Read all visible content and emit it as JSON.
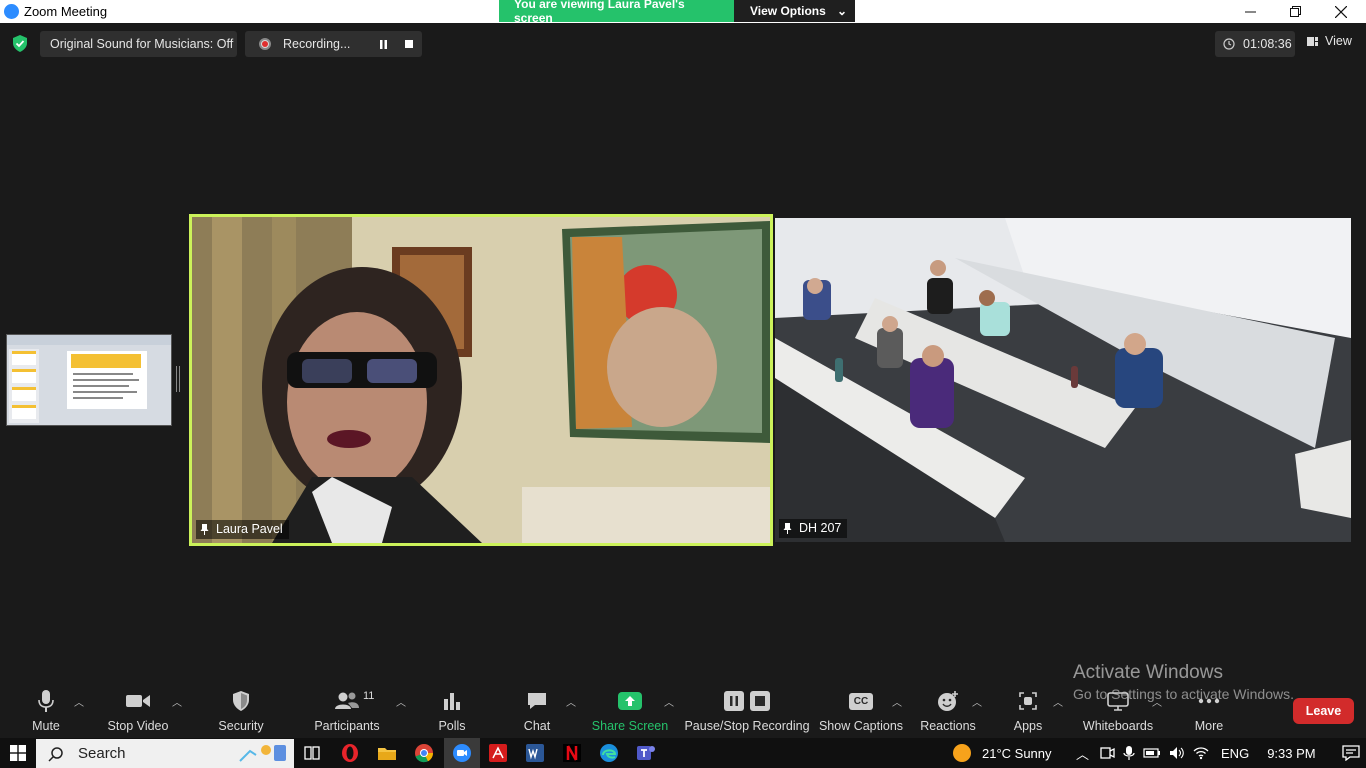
{
  "window": {
    "title": "Zoom Meeting",
    "banner_text": "You are viewing Laura Pavel's screen",
    "view_options_label": "View Options"
  },
  "top_bar": {
    "original_sound_label": "Original Sound for Musicians: Off",
    "recording_label": "Recording...",
    "timer": "01:08:36",
    "view_label": "View"
  },
  "tiles": {
    "speaker_name": "Laura Pavel",
    "room_name": "DH 207"
  },
  "watermark": {
    "line1": "Activate Windows",
    "line2": "Go to Settings to activate Windows."
  },
  "toolbar": {
    "mute": "Mute",
    "stop_video": "Stop Video",
    "security": "Security",
    "participants": "Participants",
    "participants_count": "11",
    "polls": "Polls",
    "chat": "Chat",
    "share_screen": "Share Screen",
    "pause_stop_recording": "Pause/Stop Recording",
    "cc_badge": "CC",
    "show_captions": "Show Captions",
    "reactions": "Reactions",
    "apps": "Apps",
    "whiteboards": "Whiteboards",
    "more": "More",
    "leave": "Leave"
  },
  "taskbar": {
    "search_placeholder": "Search",
    "weather": "21°C  Sunny",
    "language": "ENG",
    "time": "9:33 PM"
  },
  "colors": {
    "active_speaker_border": "#ccf25a",
    "share_green": "#25c26b",
    "leave_red": "#d22b2b"
  }
}
